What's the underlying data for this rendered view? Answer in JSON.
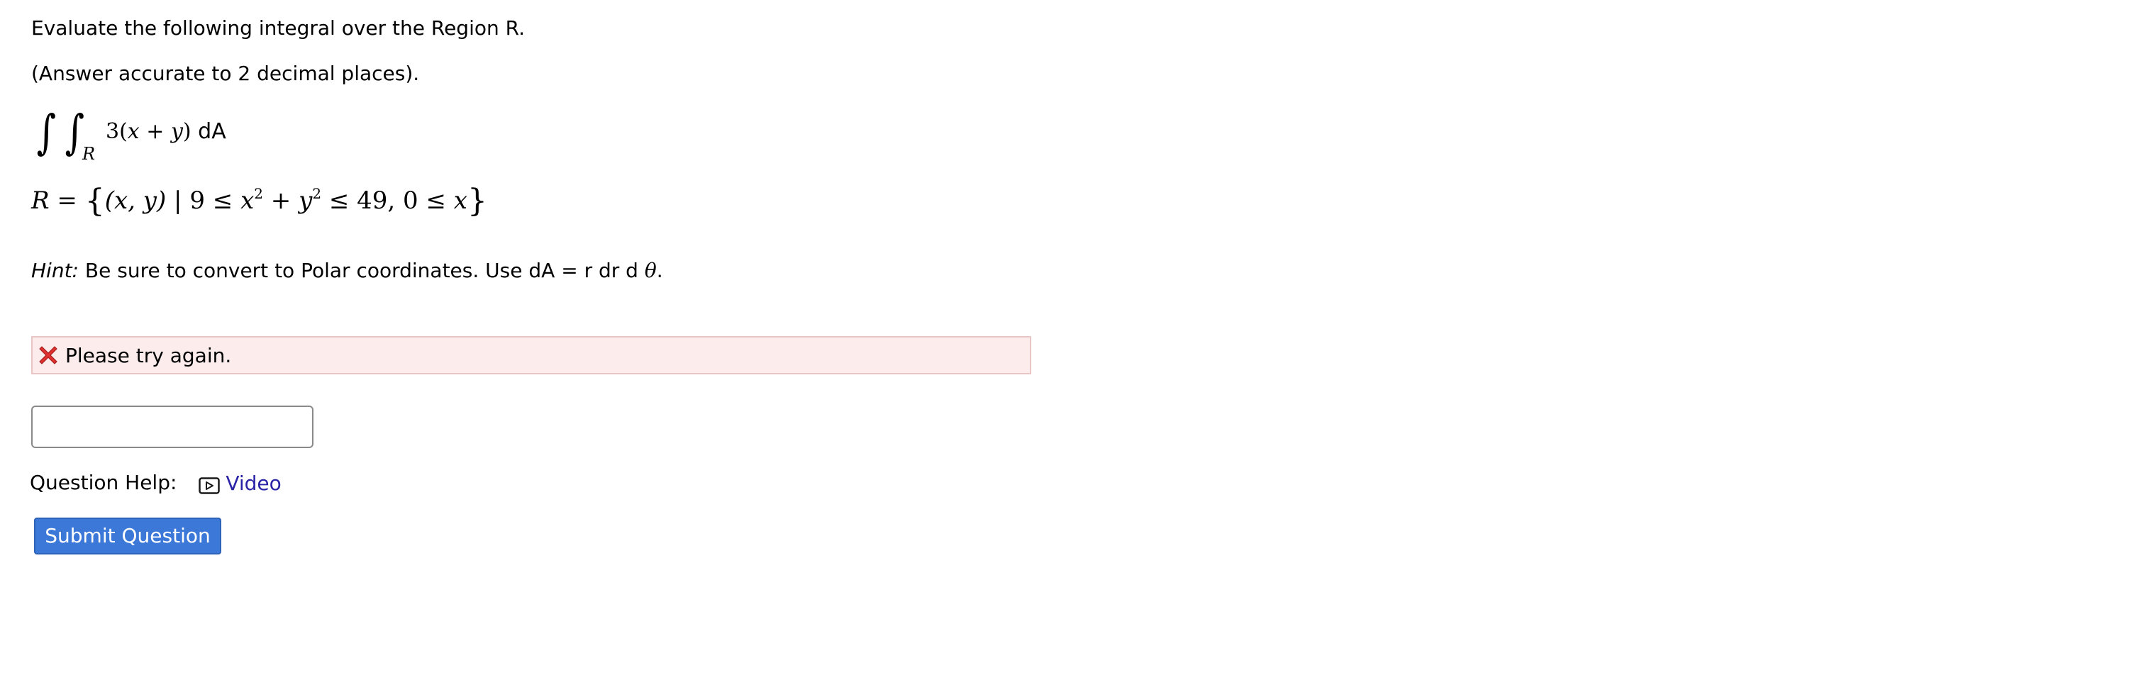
{
  "question": {
    "instruction": "Evaluate the following integral over the Region R.",
    "accuracy_note": "(Answer accurate to 2 decimal places).",
    "integral": {
      "sign1": "∫",
      "sign2": "∫",
      "subscript": "R",
      "integrand_coeff": "3(",
      "var_x": "x",
      "plus": " + ",
      "var_y": "y",
      "close_paren": ")",
      "differential": " dA"
    },
    "region": {
      "name": "R",
      "equals": " = ",
      "open_brace": "{",
      "set_head": "(x, y)",
      "bar": " | ",
      "lower_bound": "9 ≤ ",
      "x2_base": "x",
      "x2_pow": "2",
      "plus": " + ",
      "y2_base": "y",
      "y2_pow": "2",
      "upper_bound": " ≤ 49, 0 ≤ ",
      "last_var": "x",
      "close_brace": "}"
    },
    "hint": {
      "label": "Hint:",
      "text": " Be sure to convert to Polar coordinates. Use dA = r dr d ",
      "theta": "θ",
      "end": "."
    }
  },
  "feedback": {
    "status": "error",
    "message": "Please try again.",
    "icon": "x-mark-icon",
    "icon_color": "#e03131"
  },
  "answer": {
    "value": "",
    "placeholder": ""
  },
  "question_help": {
    "label": "Question Help:",
    "video_label": "Video",
    "video_icon": "video-play-icon",
    "link_color": "#2a23a6"
  },
  "submit": {
    "label": "Submit Question",
    "color": "#3c78d8"
  }
}
